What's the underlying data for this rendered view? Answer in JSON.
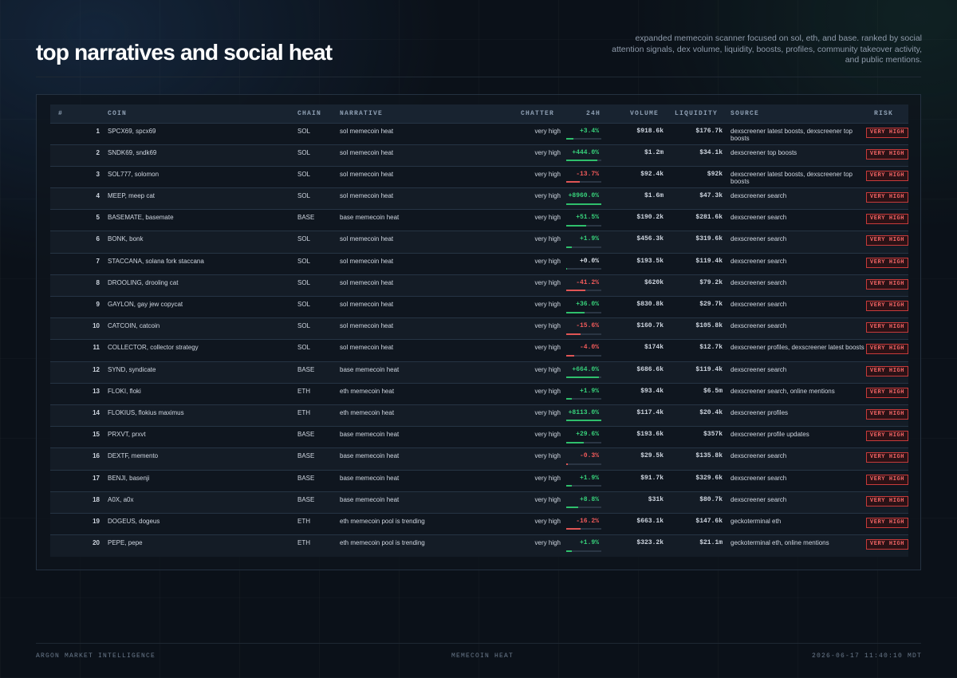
{
  "header": {
    "title": "top narratives and social heat",
    "subtitle": "expanded memecoin scanner focused on sol, eth, and base. ranked by social attention signals, dex volume, liquidity, boosts, profiles, community takeover activity, and public mentions."
  },
  "table": {
    "columns": {
      "rank": "#",
      "coin": "COIN",
      "chain": "CHAIN",
      "narrative": "NARRATIVE",
      "chatter": "CHATTER",
      "change": "24H",
      "volume": "VOLUME",
      "liquidity": "LIQUIDITY",
      "source": "SOURCE",
      "risk": "RISK"
    },
    "rows": [
      {
        "rank": "1",
        "coin": "SPCX69, spcx69",
        "chain": "SOL",
        "narrative": "sol memecoin heat",
        "chatter": "very high",
        "change": "+3.4%",
        "change_pct": 3.4,
        "volume": "$918.6k",
        "liquidity": "$176.7k",
        "source": "dexscreener latest boosts, dexscreener top boosts",
        "risk": "VERY HIGH"
      },
      {
        "rank": "2",
        "coin": "SNDK69, sndk69",
        "chain": "SOL",
        "narrative": "sol memecoin heat",
        "chatter": "very high",
        "change": "+444.0%",
        "change_pct": 444.0,
        "volume": "$1.2m",
        "liquidity": "$34.1k",
        "source": "dexscreener top boosts",
        "risk": "VERY HIGH"
      },
      {
        "rank": "3",
        "coin": "SOL777, solomon",
        "chain": "SOL",
        "narrative": "sol memecoin heat",
        "chatter": "very high",
        "change": "-13.7%",
        "change_pct": -13.7,
        "volume": "$92.4k",
        "liquidity": "$92k",
        "source": "dexscreener latest boosts, dexscreener top boosts",
        "risk": "VERY HIGH"
      },
      {
        "rank": "4",
        "coin": "MEEP, meep cat",
        "chain": "SOL",
        "narrative": "sol memecoin heat",
        "chatter": "very high",
        "change": "+8960.0%",
        "change_pct": 8960.0,
        "volume": "$1.6m",
        "liquidity": "$47.3k",
        "source": "dexscreener search",
        "risk": "VERY HIGH"
      },
      {
        "rank": "5",
        "coin": "BASEMATE, basemate",
        "chain": "BASE",
        "narrative": "base memecoin heat",
        "chatter": "very high",
        "change": "+51.5%",
        "change_pct": 51.5,
        "volume": "$190.2k",
        "liquidity": "$281.6k",
        "source": "dexscreener search",
        "risk": "VERY HIGH"
      },
      {
        "rank": "6",
        "coin": "BONK, bonk",
        "chain": "SOL",
        "narrative": "sol memecoin heat",
        "chatter": "very high",
        "change": "+1.9%",
        "change_pct": 1.9,
        "volume": "$456.3k",
        "liquidity": "$319.6k",
        "source": "dexscreener search",
        "risk": "VERY HIGH"
      },
      {
        "rank": "7",
        "coin": "STACCANA, solana fork staccana",
        "chain": "SOL",
        "narrative": "sol memecoin heat",
        "chatter": "very high",
        "change": "+0.0%",
        "change_pct": 0.0,
        "volume": "$193.5k",
        "liquidity": "$119.4k",
        "source": "dexscreener search",
        "risk": "VERY HIGH"
      },
      {
        "rank": "8",
        "coin": "DROOLING, drooling cat",
        "chain": "SOL",
        "narrative": "sol memecoin heat",
        "chatter": "very high",
        "change": "-41.2%",
        "change_pct": -41.2,
        "volume": "$620k",
        "liquidity": "$79.2k",
        "source": "dexscreener search",
        "risk": "VERY HIGH"
      },
      {
        "rank": "9",
        "coin": "GAYLON, gay jew copycat",
        "chain": "SOL",
        "narrative": "sol memecoin heat",
        "chatter": "very high",
        "change": "+36.0%",
        "change_pct": 36.0,
        "volume": "$830.8k",
        "liquidity": "$29.7k",
        "source": "dexscreener search",
        "risk": "VERY HIGH"
      },
      {
        "rank": "10",
        "coin": "CATCOIN, catcoin",
        "chain": "SOL",
        "narrative": "sol memecoin heat",
        "chatter": "very high",
        "change": "-15.6%",
        "change_pct": -15.6,
        "volume": "$160.7k",
        "liquidity": "$105.8k",
        "source": "dexscreener search",
        "risk": "VERY HIGH"
      },
      {
        "rank": "11",
        "coin": "COLLECTOR, collector strategy",
        "chain": "SOL",
        "narrative": "sol memecoin heat",
        "chatter": "very high",
        "change": "-4.0%",
        "change_pct": -4.0,
        "volume": "$174k",
        "liquidity": "$12.7k",
        "source": "dexscreener profiles, dexscreener latest boosts",
        "risk": "VERY HIGH"
      },
      {
        "rank": "12",
        "coin": "SYND, syndicate",
        "chain": "BASE",
        "narrative": "base memecoin heat",
        "chatter": "very high",
        "change": "+664.0%",
        "change_pct": 664.0,
        "volume": "$686.6k",
        "liquidity": "$119.4k",
        "source": "dexscreener search",
        "risk": "VERY HIGH"
      },
      {
        "rank": "13",
        "coin": "FLOKI, floki",
        "chain": "ETH",
        "narrative": "eth memecoin heat",
        "chatter": "very high",
        "change": "+1.9%",
        "change_pct": 1.9,
        "volume": "$93.4k",
        "liquidity": "$6.5m",
        "source": "dexscreener search, online mentions",
        "risk": "VERY HIGH"
      },
      {
        "rank": "14",
        "coin": "FLOKIUS, flokius maximus",
        "chain": "ETH",
        "narrative": "eth memecoin heat",
        "chatter": "very high",
        "change": "+8113.0%",
        "change_pct": 8113.0,
        "volume": "$117.4k",
        "liquidity": "$20.4k",
        "source": "dexscreener profiles",
        "risk": "VERY HIGH"
      },
      {
        "rank": "15",
        "coin": "PRXVT, prxvt",
        "chain": "BASE",
        "narrative": "base memecoin heat",
        "chatter": "very high",
        "change": "+29.6%",
        "change_pct": 29.6,
        "volume": "$193.6k",
        "liquidity": "$357k",
        "source": "dexscreener profile updates",
        "risk": "VERY HIGH"
      },
      {
        "rank": "16",
        "coin": "DEXTF, memento",
        "chain": "BASE",
        "narrative": "base memecoin heat",
        "chatter": "very high",
        "change": "-0.3%",
        "change_pct": -0.3,
        "volume": "$29.5k",
        "liquidity": "$135.8k",
        "source": "dexscreener search",
        "risk": "VERY HIGH"
      },
      {
        "rank": "17",
        "coin": "BENJI, basenji",
        "chain": "BASE",
        "narrative": "base memecoin heat",
        "chatter": "very high",
        "change": "+1.9%",
        "change_pct": 1.9,
        "volume": "$91.7k",
        "liquidity": "$329.6k",
        "source": "dexscreener search",
        "risk": "VERY HIGH"
      },
      {
        "rank": "18",
        "coin": "A0X, a0x",
        "chain": "BASE",
        "narrative": "base memecoin heat",
        "chatter": "very high",
        "change": "+8.8%",
        "change_pct": 8.8,
        "volume": "$31k",
        "liquidity": "$80.7k",
        "source": "dexscreener search",
        "risk": "VERY HIGH"
      },
      {
        "rank": "19",
        "coin": "DOGEUS, dogeus",
        "chain": "ETH",
        "narrative": "eth memecoin pool is trending",
        "chatter": "very high",
        "change": "-16.2%",
        "change_pct": -16.2,
        "volume": "$663.1k",
        "liquidity": "$147.6k",
        "source": "geckoterminal eth",
        "risk": "VERY HIGH"
      },
      {
        "rank": "20",
        "coin": "PEPE, pepe",
        "chain": "ETH",
        "narrative": "eth memecoin pool is trending",
        "chatter": "very high",
        "change": "+1.9%",
        "change_pct": 1.9,
        "volume": "$323.2k",
        "liquidity": "$21.1m",
        "source": "geckoterminal eth, online mentions",
        "risk": "VERY HIGH"
      }
    ]
  },
  "footer": {
    "left": "ARGON MARKET INTELLIGENCE",
    "center": "MEMECOIN HEAT",
    "right": "2026-06-17 11:40:10 MDT"
  },
  "colors": {
    "up": "#37d07a",
    "down": "#f05a5a",
    "risk": "#c73a3a",
    "background": "#0b1119"
  }
}
